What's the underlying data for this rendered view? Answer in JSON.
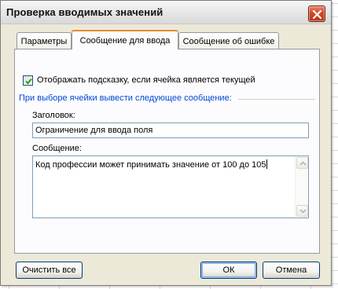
{
  "window": {
    "title": "Проверка вводимых значений"
  },
  "tabs": [
    {
      "label": "Параметры"
    },
    {
      "label": "Сообщение для ввода"
    },
    {
      "label": "Сообщение об ошибке"
    }
  ],
  "active_tab": "Сообщение для ввода",
  "show_hint": {
    "checked": true,
    "label": "Отображать подсказку, если ячейка является текущей"
  },
  "group": {
    "title": "При выборе ячейки вывести следующее сообщение:"
  },
  "title_field": {
    "label": "Заголовок:",
    "value": "Ограничение для ввода поля"
  },
  "message_field": {
    "label": "Сообщение:",
    "value": "Код профессии может принимать значение от 100 до 105"
  },
  "buttons": {
    "clear_all": "Очистить все",
    "ok": "ОК",
    "cancel": "Отмена"
  },
  "colors": {
    "dialog_bg": "#ece9d8",
    "active_tab_accent": "#e68b2c",
    "group_title": "#0046d5",
    "close_button": "#cf4a2a"
  }
}
